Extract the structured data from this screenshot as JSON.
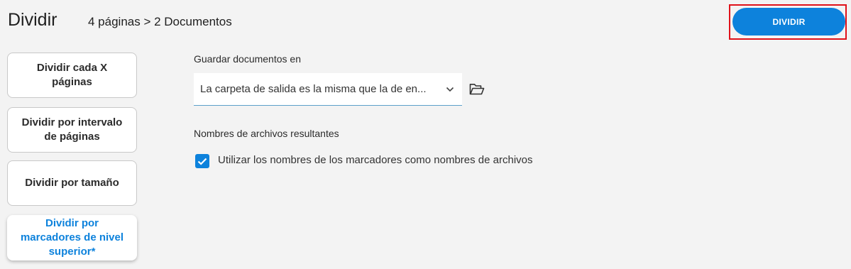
{
  "header": {
    "title": "Dividir",
    "summary": "4 páginas > 2 Documentos",
    "action_label": "DIVIDIR"
  },
  "modes": [
    {
      "label": "Dividir cada X páginas",
      "active": false
    },
    {
      "label": "Dividir por intervalo de páginas",
      "active": false
    },
    {
      "label": "Dividir por tamaño",
      "active": false
    },
    {
      "label": "Dividir por marcadores de nivel superior*",
      "active": true
    }
  ],
  "output": {
    "label": "Guardar documentos en",
    "selected": "La carpeta de salida es la misma que la de en...",
    "icons": [
      "chevron-down-icon",
      "folder-open-icon"
    ]
  },
  "filenames": {
    "label": "Nombres de archivos resultantes",
    "checkbox_label": "Utilizar los nombres de los marcadores como nombres de archivos",
    "checked": true
  },
  "colors": {
    "accent": "#0d82dc",
    "highlight": "#e0121a",
    "background": "#f3f3f3"
  }
}
